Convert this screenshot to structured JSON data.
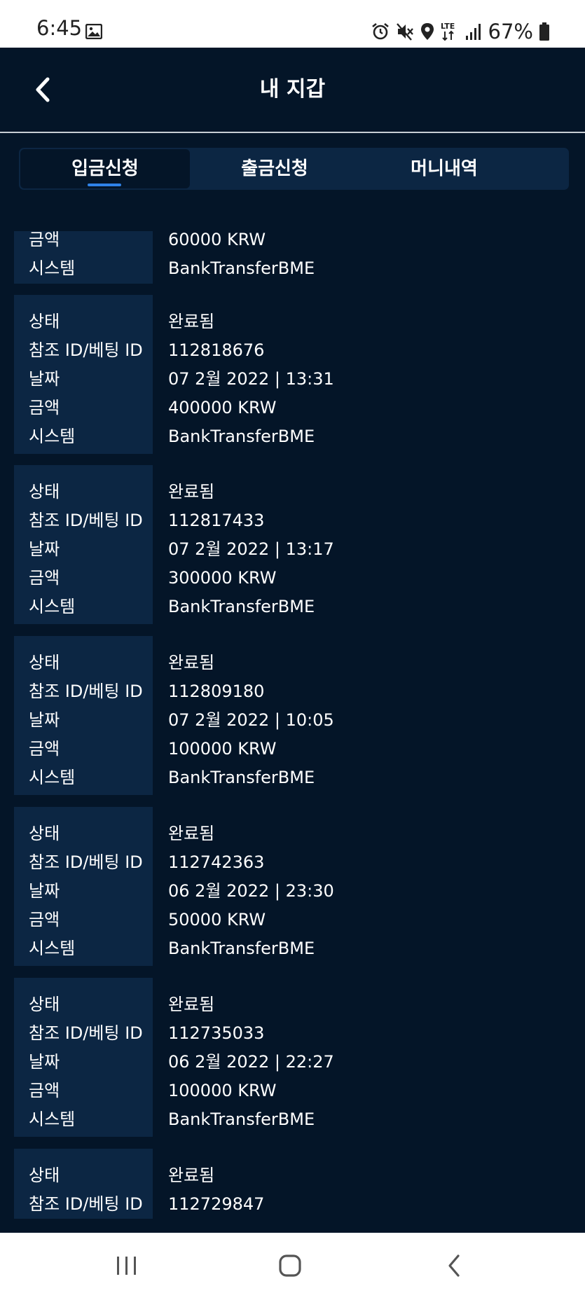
{
  "status_bar": {
    "time": "6:45",
    "battery": "67%",
    "icons": [
      "gallery-icon",
      "alarm-icon",
      "mute-icon",
      "location-icon",
      "lte-icon",
      "signal-icon",
      "battery-icon"
    ]
  },
  "header": {
    "title": "내 지갑",
    "back_icon": "chevron-left-icon"
  },
  "tabs": [
    {
      "label": "입금신청",
      "active": true
    },
    {
      "label": "출금신청",
      "active": false
    },
    {
      "label": "머니내역",
      "active": false
    }
  ],
  "labels": {
    "status": "상태",
    "ref_id": "참조 ID/베팅 ID",
    "date": "날짜",
    "amount": "금액",
    "system": "시스템"
  },
  "partial_top_card": {
    "amount": "60000 KRW",
    "system": "BankTransferBME"
  },
  "transactions": [
    {
      "status": "완료됨",
      "ref_id": "112818676",
      "date": "07 2월 2022 | 13:31",
      "amount": "400000 KRW",
      "system": "BankTransferBME"
    },
    {
      "status": "완료됨",
      "ref_id": "112817433",
      "date": "07 2월 2022 | 13:17",
      "amount": "300000 KRW",
      "system": "BankTransferBME"
    },
    {
      "status": "완료됨",
      "ref_id": "112809180",
      "date": "07 2월 2022 | 10:05",
      "amount": "100000 KRW",
      "system": "BankTransferBME"
    },
    {
      "status": "완료됨",
      "ref_id": "112742363",
      "date": "06 2월 2022 | 23:30",
      "amount": "50000 KRW",
      "system": "BankTransferBME"
    },
    {
      "status": "완료됨",
      "ref_id": "112735033",
      "date": "06 2월 2022 | 22:27",
      "amount": "100000 KRW",
      "system": "BankTransferBME"
    }
  ],
  "partial_bottom_card": {
    "status": "완료됨",
    "ref_id": "112729847"
  },
  "nav_bar": {
    "icons": [
      "recent-apps-icon",
      "home-icon",
      "back-icon"
    ]
  },
  "colors": {
    "background": "#041528",
    "panel": "#0c2643",
    "accent": "#2f82e8",
    "text": "#ffffff"
  }
}
